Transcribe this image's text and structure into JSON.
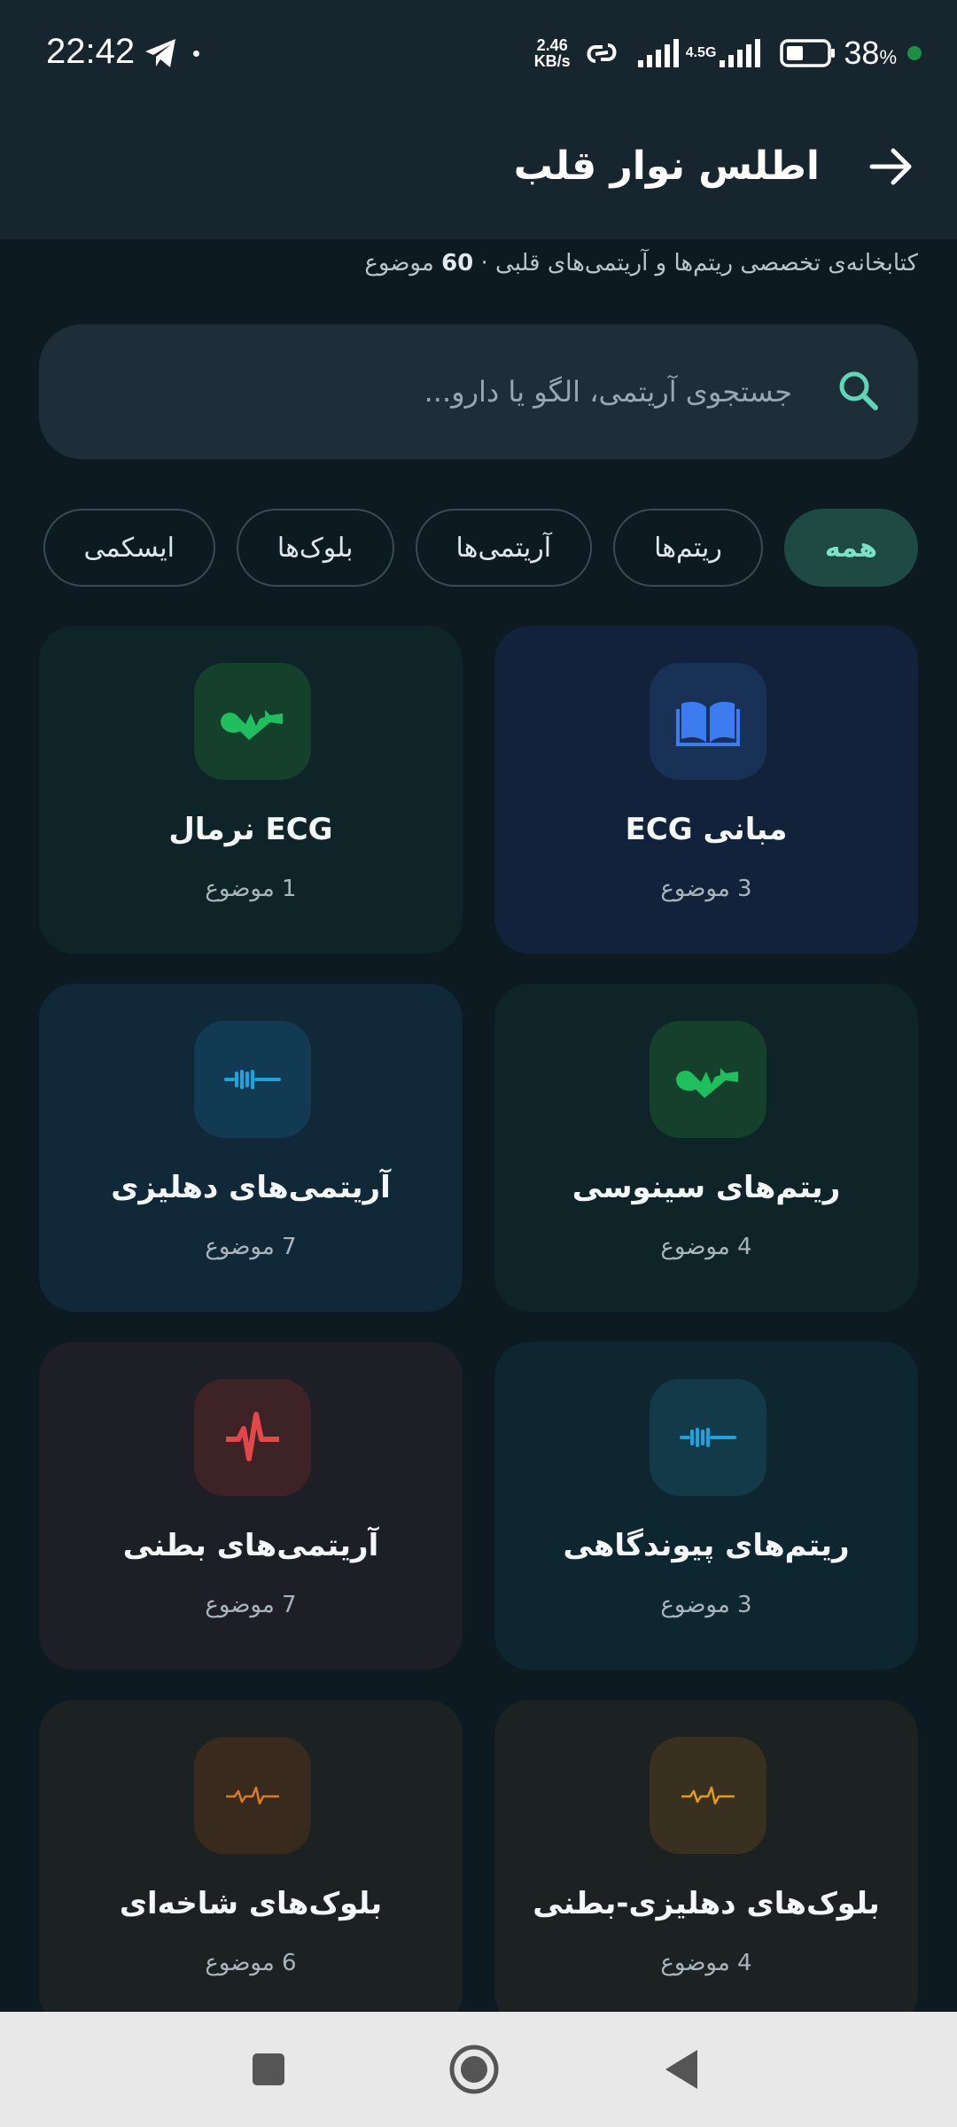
{
  "status_bar": {
    "time": "22:42",
    "speed_value": "2.46",
    "speed_unit": "KB/s",
    "network_label": "4.5G",
    "battery_percent": "38",
    "battery_symbol": "%"
  },
  "header": {
    "title": "اطلس نوار قلب"
  },
  "subtitle": {
    "text": "کتابخانه‌ی تخصصی ریتم‌ها و آریتمی‌های قلبی · ",
    "count": "60",
    "unit": " موضوع"
  },
  "search": {
    "placeholder": "جستجوی آریتمی، الگو یا دارو..."
  },
  "chips": [
    {
      "label": "همه",
      "active": true
    },
    {
      "label": "ریتم‌ها",
      "active": false
    },
    {
      "label": "آریتمی‌ها",
      "active": false
    },
    {
      "label": "بلوک‌ها",
      "active": false
    },
    {
      "label": "ایسکمی",
      "active": false
    }
  ],
  "cards": [
    {
      "title": "مبانی ECG",
      "count": "3 موضوع",
      "icon": "book-icon",
      "accent": "#3d7bf0",
      "bg": "#12223a",
      "icon_bg": "#1a3156"
    },
    {
      "title": "ECG نرمال",
      "count": "1 موضوع",
      "icon": "heartbeat-icon",
      "accent": "#1fbf5e",
      "bg": "#0f2428",
      "icon_bg": "#14402c"
    },
    {
      "title": "ریتم‌های سینوسی",
      "count": "4 موضوع",
      "icon": "heartbeat-icon",
      "accent": "#1fbf5e",
      "bg": "#0f2428",
      "icon_bg": "#14402c"
    },
    {
      "title": "آریتمی‌های دهلیزی",
      "count": "7 موضوع",
      "icon": "fibrillation-wave-icon",
      "accent": "#1aa4e0",
      "bg": "#102838",
      "icon_bg": "#123a52"
    },
    {
      "title": "ریتم‌های پیوندگاهی",
      "count": "3 موضوع",
      "icon": "fibrillation-wave-icon",
      "accent": "#1aa4e0",
      "bg": "#0e2630",
      "icon_bg": "#123a48"
    },
    {
      "title": "آریتمی‌های بطنی",
      "count": "7 موضوع",
      "icon": "ecg-spike-icon",
      "accent": "#e24848",
      "bg": "#1e1e26",
      "icon_bg": "#3d2226"
    },
    {
      "title": "بلوک‌های دهلیزی-بطنی",
      "count": "4 موضوع",
      "icon": "ecg-wave-icon",
      "accent": "#e69a1e",
      "bg": "#1c2222",
      "icon_bg": "#3a3020"
    },
    {
      "title": "بلوک‌های شاخه‌ای",
      "count": "6 موضوع",
      "icon": "ecg-wave-icon",
      "accent": "#e07a1e",
      "bg": "#1c2222",
      "icon_bg": "#392a1e"
    }
  ]
}
